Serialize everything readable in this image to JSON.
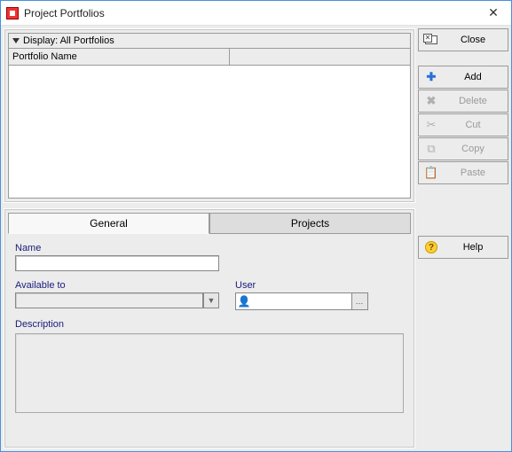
{
  "window": {
    "title": "Project Portfolios"
  },
  "top_panel": {
    "display_label": "Display: All Portfolios",
    "columns": [
      "Portfolio Name",
      ""
    ]
  },
  "tabs": {
    "general": "General",
    "projects": "Projects",
    "active": "general"
  },
  "form": {
    "name_label": "Name",
    "name_value": "",
    "available_label": "Available to",
    "available_value": "",
    "user_label": "User",
    "user_value": "",
    "description_label": "Description",
    "description_value": ""
  },
  "buttons": {
    "close": "Close",
    "add": "Add",
    "delete": "Delete",
    "cut": "Cut",
    "copy": "Copy",
    "paste": "Paste",
    "help": "Help"
  }
}
